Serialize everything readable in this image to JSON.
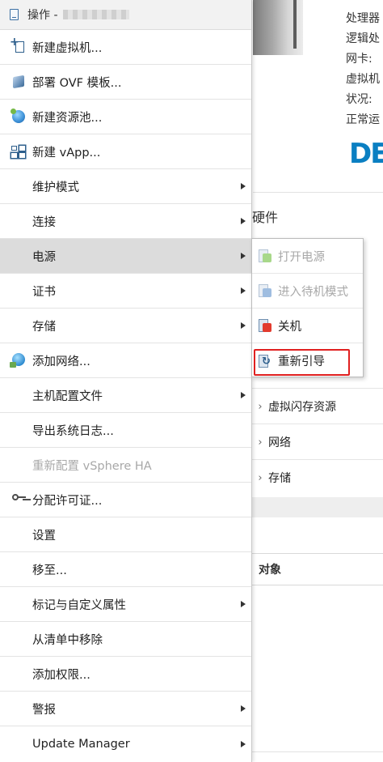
{
  "menu": {
    "header": {
      "title": "操作 -"
    },
    "items": [
      {
        "label": "新建虚拟机...",
        "icon": "new-vm-icon",
        "has_submenu": false,
        "enabled": true
      },
      {
        "label": "部署 OVF 模板...",
        "icon": "ovf-template-icon",
        "has_submenu": false,
        "enabled": true
      },
      {
        "label": "新建资源池...",
        "icon": "resource-pool-icon",
        "has_submenu": false,
        "enabled": true
      },
      {
        "label": "新建 vApp...",
        "icon": "vapp-icon",
        "has_submenu": false,
        "enabled": true
      },
      {
        "label": "维护模式",
        "has_submenu": true,
        "enabled": true
      },
      {
        "label": "连接",
        "has_submenu": true,
        "enabled": true
      },
      {
        "label": "电源",
        "has_submenu": true,
        "enabled": true,
        "selected": true
      },
      {
        "label": "证书",
        "has_submenu": true,
        "enabled": true
      },
      {
        "label": "存储",
        "has_submenu": true,
        "enabled": true
      },
      {
        "label": "添加网络...",
        "icon": "add-network-icon",
        "has_submenu": false,
        "enabled": true
      },
      {
        "label": "主机配置文件",
        "has_submenu": true,
        "enabled": true
      },
      {
        "label": "导出系统日志...",
        "has_submenu": false,
        "enabled": true
      },
      {
        "label": "重新配置 vSphere HA",
        "has_submenu": false,
        "enabled": false
      },
      {
        "label": "分配许可证...",
        "icon": "license-key-icon",
        "has_submenu": false,
        "enabled": true
      },
      {
        "label": "设置",
        "has_submenu": false,
        "enabled": true
      },
      {
        "label": "移至...",
        "has_submenu": false,
        "enabled": true
      },
      {
        "label": "标记与自定义属性",
        "has_submenu": true,
        "enabled": true
      },
      {
        "label": "从清单中移除",
        "has_submenu": false,
        "enabled": true
      },
      {
        "label": "添加权限...",
        "has_submenu": false,
        "enabled": true
      },
      {
        "label": "警报",
        "has_submenu": true,
        "enabled": true
      },
      {
        "label": "Update Manager",
        "has_submenu": true,
        "enabled": true
      }
    ]
  },
  "power_submenu": {
    "items": [
      {
        "label": "打开电源",
        "icon": "power-on-icon",
        "enabled": false
      },
      {
        "label": "进入待机模式",
        "icon": "standby-icon",
        "enabled": false
      },
      {
        "label": "关机",
        "icon": "shutdown-icon",
        "enabled": true
      },
      {
        "label": "重新引导",
        "icon": "reboot-icon",
        "enabled": true,
        "highlighted": true
      }
    ],
    "highlight_color": "#e02020"
  },
  "background": {
    "info_lines": [
      "处理器",
      "逻辑处",
      "网卡:",
      "虚拟机",
      "状况:",
      "正常运"
    ],
    "logo_text": "DELL",
    "hardware_heading": "硬件",
    "tree_rows": [
      "虚拟闪存资源",
      "网络",
      "存储"
    ],
    "table_header": "对象"
  },
  "colors": {
    "selected_bg": "#dcdcdc",
    "disabled_text": "#a8a8a8",
    "logo": "#0a7fc2"
  }
}
